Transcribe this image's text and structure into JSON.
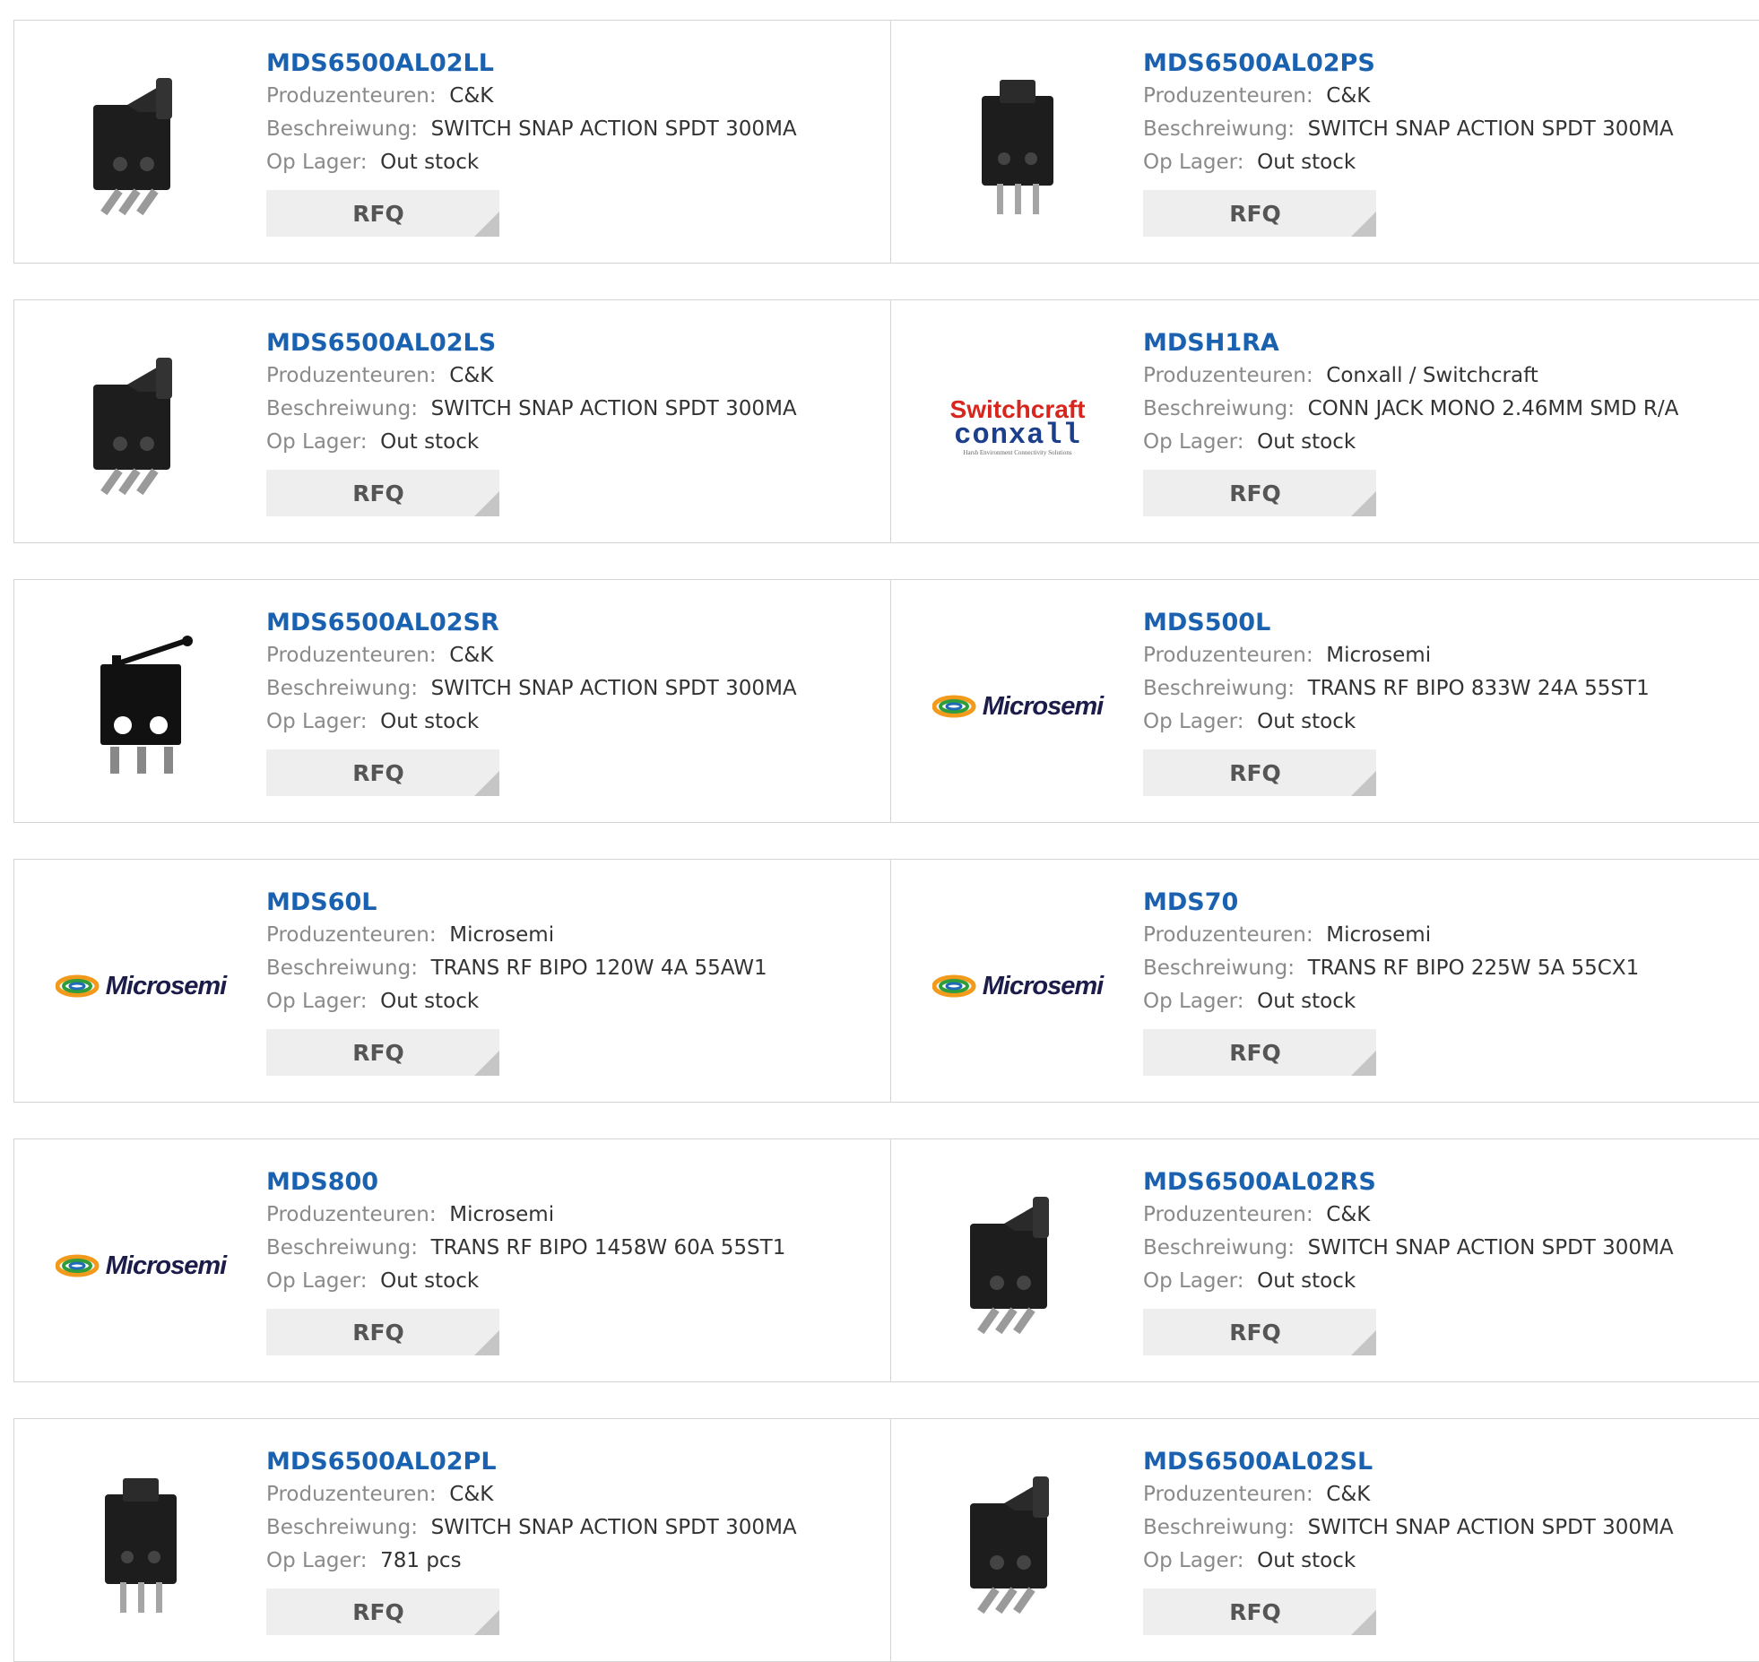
{
  "labels": {
    "manufacturer": "Produzenteuren:",
    "description": "Beschreiwung:",
    "stock": "Op Lager:",
    "rfq": "RFQ"
  },
  "logos": {
    "microsemi": "Microsemi",
    "switchcraft": "Switchcraft",
    "conxall": "conxall",
    "conxall_tagline": "Harsh Environment Connectivity Solutions"
  },
  "products": [
    {
      "part": "MDS6500AL02LL",
      "manufacturer": "C&K",
      "description": "SWITCH SNAP ACTION SPDT 300MA",
      "stock": "Out stock",
      "image": "switch-lever-icon"
    },
    {
      "part": "MDS6500AL02PS",
      "manufacturer": "C&K",
      "description": "SWITCH SNAP ACTION SPDT 300MA",
      "stock": "Out stock",
      "image": "switch-pins-icon"
    },
    {
      "part": "MDS6500AL02LS",
      "manufacturer": "C&K",
      "description": "SWITCH SNAP ACTION SPDT 300MA",
      "stock": "Out stock",
      "image": "switch-lever-icon"
    },
    {
      "part": "MDSH1RA",
      "manufacturer": "Conxall / Switchcraft",
      "description": "CONN JACK MONO 2.46MM SMD R/A",
      "stock": "Out stock",
      "image": "switchcraft-conxall-logo"
    },
    {
      "part": "MDS6500AL02SR",
      "manufacturer": "C&K",
      "description": "SWITCH SNAP ACTION SPDT 300MA",
      "stock": "Out stock",
      "image": "switch-roller-icon"
    },
    {
      "part": "MDS500L",
      "manufacturer": "Microsemi",
      "description": "TRANS RF BIPO 833W 24A 55ST1",
      "stock": "Out stock",
      "image": "microsemi-logo"
    },
    {
      "part": "MDS60L",
      "manufacturer": "Microsemi",
      "description": "TRANS RF BIPO 120W 4A 55AW1",
      "stock": "Out stock",
      "image": "microsemi-logo"
    },
    {
      "part": "MDS70",
      "manufacturer": "Microsemi",
      "description": "TRANS RF BIPO 225W 5A 55CX1",
      "stock": "Out stock",
      "image": "microsemi-logo"
    },
    {
      "part": "MDS800",
      "manufacturer": "Microsemi",
      "description": "TRANS RF BIPO 1458W 60A 55ST1",
      "stock": "Out stock",
      "image": "microsemi-logo"
    },
    {
      "part": "MDS6500AL02RS",
      "manufacturer": "C&K",
      "description": "SWITCH SNAP ACTION SPDT 300MA",
      "stock": "Out stock",
      "image": "switch-lever-icon"
    },
    {
      "part": "MDS6500AL02PL",
      "manufacturer": "C&K",
      "description": "SWITCH SNAP ACTION SPDT 300MA",
      "stock": "781 pcs",
      "image": "switch-pins-icon"
    },
    {
      "part": "MDS6500AL02SL",
      "manufacturer": "C&K",
      "description": "SWITCH SNAP ACTION SPDT 300MA",
      "stock": "Out stock",
      "image": "switch-lever-icon"
    }
  ],
  "colors": {
    "part_link": "#1a62b0",
    "label": "#8a8a8a",
    "value": "#333333",
    "rfq_bg": "#eeeeee",
    "border": "#d4d4d4"
  }
}
